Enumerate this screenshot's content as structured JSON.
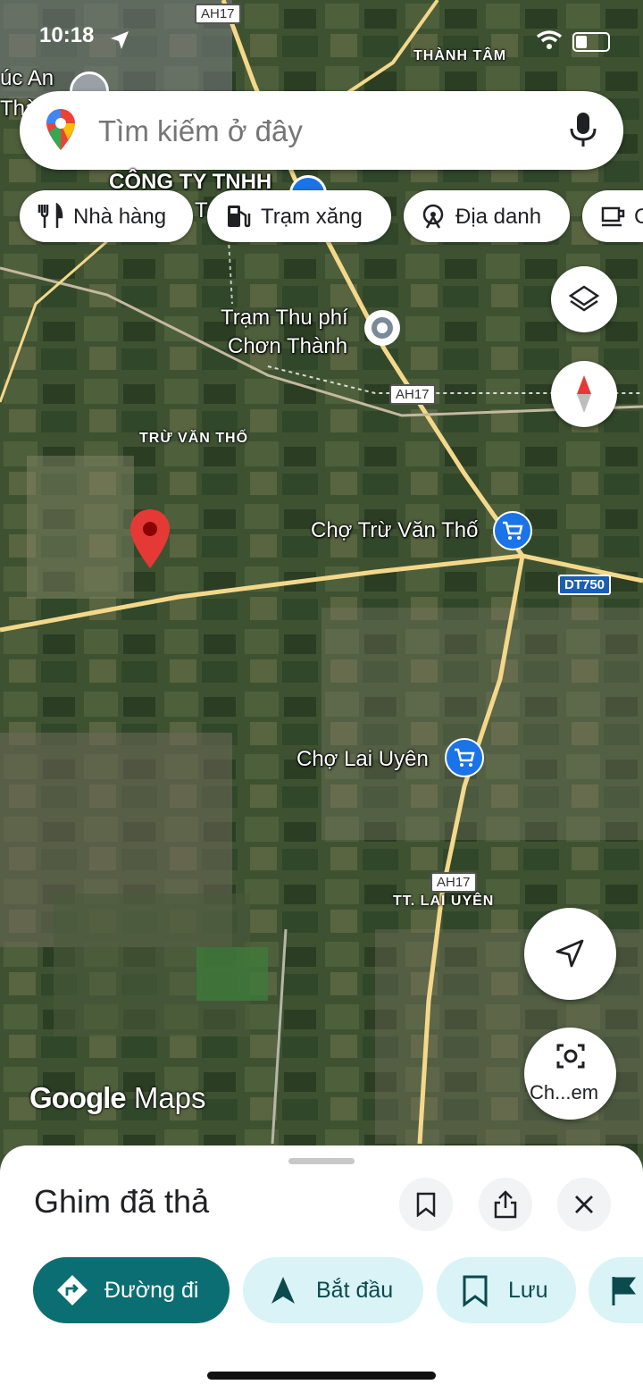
{
  "status_bar": {
    "time": "10:18"
  },
  "search": {
    "placeholder": "Tìm kiếm ở đây"
  },
  "chips": [
    {
      "label": "Nhà hàng",
      "icon": "restaurant-icon"
    },
    {
      "label": "Trạm xăng",
      "icon": "gas-station-icon"
    },
    {
      "label": "Địa danh",
      "icon": "landmark-icon"
    },
    {
      "label": "C",
      "icon": "coffee-icon"
    }
  ],
  "map_labels": {
    "tram_thu_phi_1": "Trạm Thu phí",
    "tram_thu_phi_2": "Chơn Thành",
    "tru_van_tho_area": "TRỪ VĂN THỐ",
    "cho_tru_van_tho": "Chợ Trừ Văn Thố",
    "cho_lai_uyen": "Chợ Lai Uyên",
    "tt_lai_uyen": "TT. LAI UYÊN",
    "thanh_tam": "THÀNH TÂM",
    "cong_ty": "CÔNG TY TNHH",
    "cong_ty_suffix": "T",
    "phuc_an_1": "úc An",
    "phuc_an_2": "Thà",
    "ah17_top": "AH17",
    "ah17_mid": "AH17",
    "ah17_bottom": "AH17",
    "dt750": "DT750",
    "camera_label": "Ch...em"
  },
  "branding": {
    "logo_word1": "Google",
    "logo_word2": "Maps"
  },
  "sheet": {
    "title": "Ghim đã thả",
    "buttons": [
      {
        "label": "Đường đi",
        "icon": "directions-icon"
      },
      {
        "label": "Bắt đầu",
        "icon": "navigation-arrow-icon"
      },
      {
        "label": "Lưu",
        "icon": "bookmark-icon"
      }
    ]
  },
  "colors": {
    "primary_teal": "#0b6e72",
    "light_teal": "#d9f3f7",
    "pin_red": "#e53935",
    "road_yellow": "#f4d88a",
    "poi_blue": "#1a73e8"
  }
}
